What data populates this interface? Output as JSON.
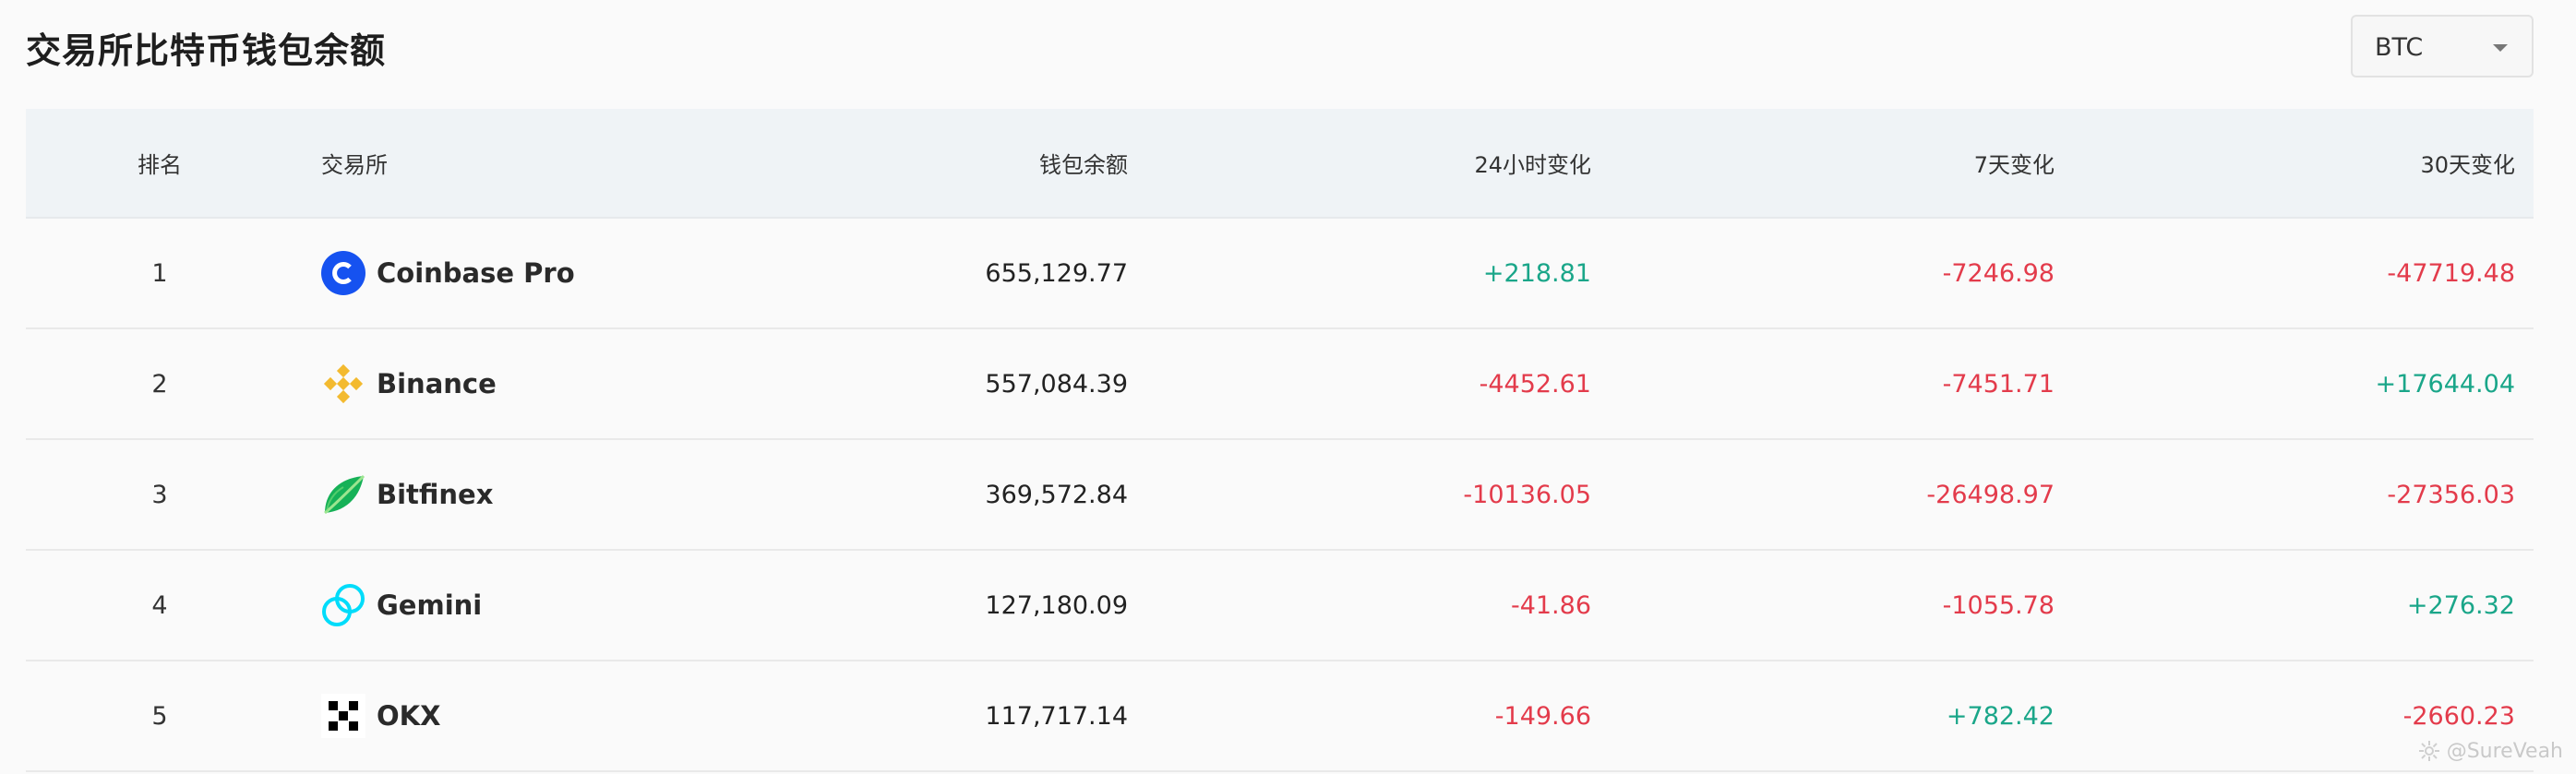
{
  "page": {
    "title": "交易所比特币钱包余额"
  },
  "currency_select": {
    "value": "BTC"
  },
  "table": {
    "headers": {
      "rank": "排名",
      "exchange": "交易所",
      "balance": "钱包余额",
      "change_24h": "24小时变化",
      "change_7d": "7天变化",
      "change_30d": "30天变化"
    },
    "rows": [
      {
        "rank": "1",
        "exchange": "Coinbase Pro",
        "icon": "coinbase-logo-icon",
        "balance": "655,129.77",
        "change_24h": "+218.81",
        "change_7d": "-7246.98",
        "change_30d": "-47719.48"
      },
      {
        "rank": "2",
        "exchange": "Binance",
        "icon": "binance-logo-icon",
        "balance": "557,084.39",
        "change_24h": "-4452.61",
        "change_7d": "-7451.71",
        "change_30d": "+17644.04"
      },
      {
        "rank": "3",
        "exchange": "Bitfinex",
        "icon": "bitfinex-logo-icon",
        "balance": "369,572.84",
        "change_24h": "-10136.05",
        "change_7d": "-26498.97",
        "change_30d": "-27356.03"
      },
      {
        "rank": "4",
        "exchange": "Gemini",
        "icon": "gemini-logo-icon",
        "balance": "127,180.09",
        "change_24h": "-41.86",
        "change_7d": "-1055.78",
        "change_30d": "+276.32"
      },
      {
        "rank": "5",
        "exchange": "OKX",
        "icon": "okx-logo-icon",
        "balance": "117,717.14",
        "change_24h": "-149.66",
        "change_7d": "+782.42",
        "change_30d": "-2660.23"
      }
    ]
  },
  "watermark": {
    "text": "@SureVeah"
  },
  "colors": {
    "positive": "#1aa689",
    "negative": "#e33b4b",
    "header_bg": "#eff3f6",
    "page_bg": "#fafafa"
  }
}
